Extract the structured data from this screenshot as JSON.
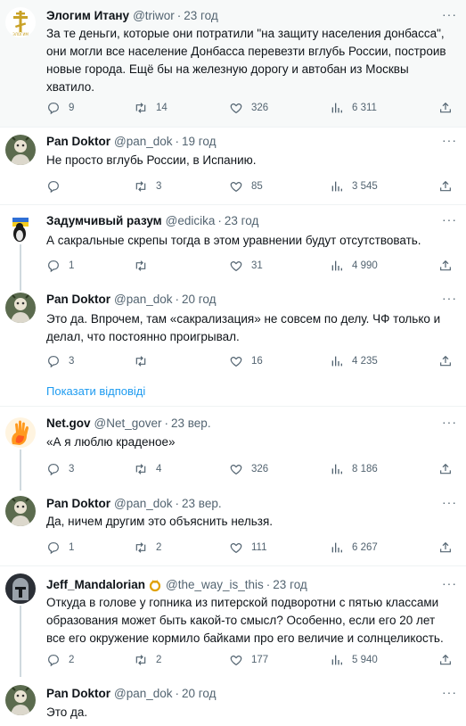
{
  "colors": {
    "accent": "#1d9bf0",
    "text": "#0f1419",
    "secondary": "#536471",
    "divider": "#eff3f4",
    "highlight_bg": "#f7f9f9"
  },
  "tweets": [
    {
      "name": "Элогим Итану",
      "handle": "@triwor",
      "dot": "·",
      "time": "23 год",
      "text": "За те деньги, которые они потратили \"на защиту населения донбасса\", они могли все население Донбасса перевезти вглубь России, построив новые города. Ещё бы на железную дорогу и автобан из Москвы хватило.",
      "replies": "9",
      "retweets": "14",
      "likes": "326",
      "views": "6 311",
      "more": "···",
      "avatar_icon": "orthodox-cross-icon"
    },
    {
      "name": "Pan Doktor",
      "handle": "@pan_dok",
      "dot": "·",
      "time": "19 год",
      "text": "Не просто вглубь России, в Испанию.",
      "replies": "",
      "retweets": "3",
      "likes": "85",
      "views": "3 545",
      "more": "···",
      "avatar_icon": "doctor-avatar-icon"
    },
    {
      "name": "Задумчивый разум",
      "handle": "@edicika",
      "dot": "·",
      "time": "23 год",
      "text": "А сакральные скрепы тогда в этом уравнении будут отсутствовать.",
      "replies": "1",
      "retweets": "",
      "likes": "31",
      "views": "4 990",
      "more": "···",
      "avatar_icon": "penguin-flag-icon"
    },
    {
      "name": "Pan Doktor",
      "handle": "@pan_dok",
      "dot": "·",
      "time": "20 год",
      "text": "Это да. Впрочем, там «сакрализация» не совсем по делу. ЧФ только и делал, что постоянно проигрывал.",
      "replies": "3",
      "retweets": "",
      "likes": "16",
      "views": "4 235",
      "more": "···",
      "avatar_icon": "doctor-avatar-icon"
    },
    {
      "name": "Net.gov",
      "handle": "@Net_gover",
      "dot": "·",
      "time": "23 вер.",
      "text": "«А я люблю краденое»",
      "replies": "3",
      "retweets": "4",
      "likes": "326",
      "views": "8 186",
      "more": "···",
      "avatar_icon": "flame-hand-icon"
    },
    {
      "name": "Pan Doktor",
      "handle": "@pan_dok",
      "dot": "·",
      "time": "23 вер.",
      "text": "Да, ничем другим это объяснить нельзя.",
      "replies": "1",
      "retweets": "2",
      "likes": "111",
      "views": "6 267",
      "more": "···",
      "avatar_icon": "doctor-avatar-icon"
    },
    {
      "name": "Jeff_Mandalorian",
      "handle": "@the_way_is_this",
      "dot": "·",
      "time": "23 год",
      "text": "Откуда в голове у гопника из питерской подворотни с пятью классами образования может быть какой-то смысл? Особенно, если его 20 лет все его окружение кормило байками про его величие и солнцеликость.",
      "replies": "2",
      "retweets": "2",
      "likes": "177",
      "views": "5 940",
      "more": "···",
      "avatar_icon": "mandalorian-helmet-icon"
    },
    {
      "name": "Pan Doktor",
      "handle": "@pan_dok",
      "dot": "·",
      "time": "20 год",
      "text": "Это да.",
      "more": "···",
      "avatar_icon": "doctor-avatar-icon"
    }
  ],
  "show_replies_label": "Показати відповіді"
}
